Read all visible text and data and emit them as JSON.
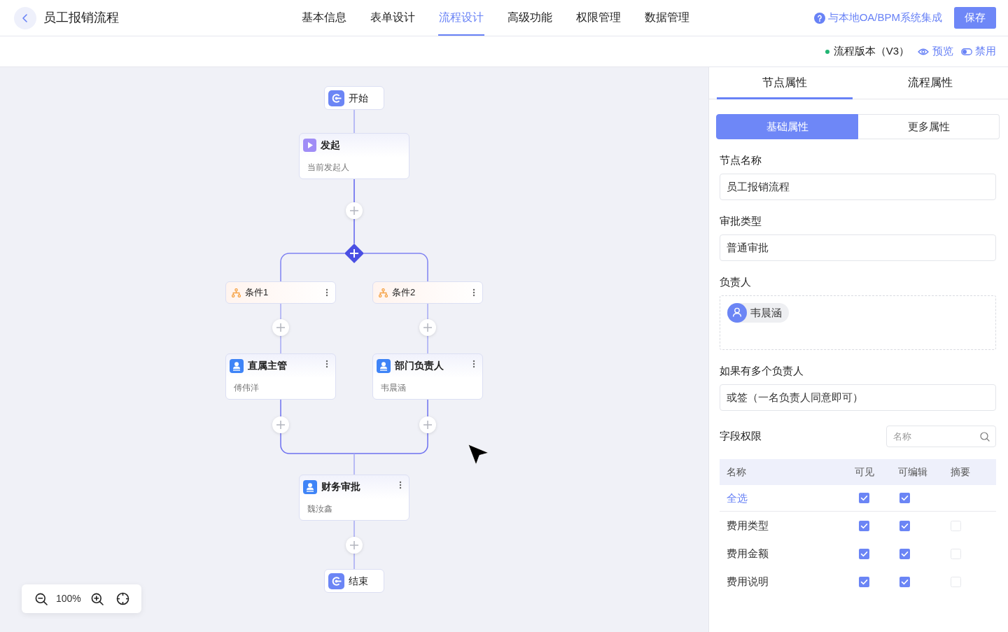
{
  "header": {
    "title": "员工报销流程",
    "tabs": [
      {
        "label": "基本信息",
        "selected": false
      },
      {
        "label": "表单设计",
        "selected": false
      },
      {
        "label": "流程设计",
        "selected": true
      },
      {
        "label": "高级功能",
        "selected": false
      },
      {
        "label": "权限管理",
        "selected": false
      },
      {
        "label": "数据管理",
        "selected": false
      }
    ],
    "integration_link": "与本地OA/BPM系统集成",
    "save_button": "保存"
  },
  "toolbar": {
    "version": "流程版本（V3）",
    "preview": "预览",
    "disable": "禁用"
  },
  "flow": {
    "nodes": [
      {
        "kind": "terminal",
        "title": "开始"
      },
      {
        "kind": "initiator",
        "title": "发起",
        "subtitle": "当前发起人"
      },
      {
        "kind": "gateway",
        "branches": [
          {
            "condition": "条件1",
            "nodes": [
              {
                "kind": "approver",
                "title": "直属主管",
                "subtitle": "傅伟洋"
              }
            ]
          },
          {
            "condition": "条件2",
            "nodes": [
              {
                "kind": "approver",
                "title": "部门负责人",
                "subtitle": "韦晨涵"
              }
            ]
          }
        ]
      },
      {
        "kind": "approver",
        "title": "财务审批",
        "subtitle": "魏汝鑫"
      },
      {
        "kind": "terminal",
        "title": "结束"
      }
    ]
  },
  "zoom_controls": {
    "zoom_text": "100%"
  },
  "properties_panel": {
    "tabs": [
      {
        "label": "节点属性",
        "selected": true
      },
      {
        "label": "流程属性",
        "selected": false
      }
    ],
    "sub_tabs": [
      {
        "label": "基础属性",
        "selected": true
      },
      {
        "label": "更多属性",
        "selected": false
      }
    ],
    "fields": [
      {
        "kind": "input",
        "label": "节点名称",
        "value": "员工报销流程"
      },
      {
        "kind": "input",
        "label": "审批类型",
        "value": "普通审批"
      },
      {
        "kind": "people",
        "label": "负责人",
        "people": [
          {
            "name": "韦晨涵"
          }
        ]
      },
      {
        "kind": "input",
        "label": "如果有多个负责人",
        "value": "或签（一名负责人同意即可）"
      }
    ],
    "field_permissions": {
      "title": "字段权限",
      "search": {
        "placeholder": "名称"
      },
      "columns": [
        "名称",
        "可见",
        "可编辑",
        "摘要"
      ],
      "select_all": {
        "label": "全选",
        "visible": true,
        "editable": true
      },
      "rows": [
        {
          "name": "费用类型",
          "visible": true,
          "editable": true,
          "summary": false
        },
        {
          "name": "费用金额",
          "visible": true,
          "editable": true,
          "summary": false
        },
        {
          "name": "费用说明",
          "visible": true,
          "editable": true,
          "summary": false
        }
      ]
    }
  }
}
